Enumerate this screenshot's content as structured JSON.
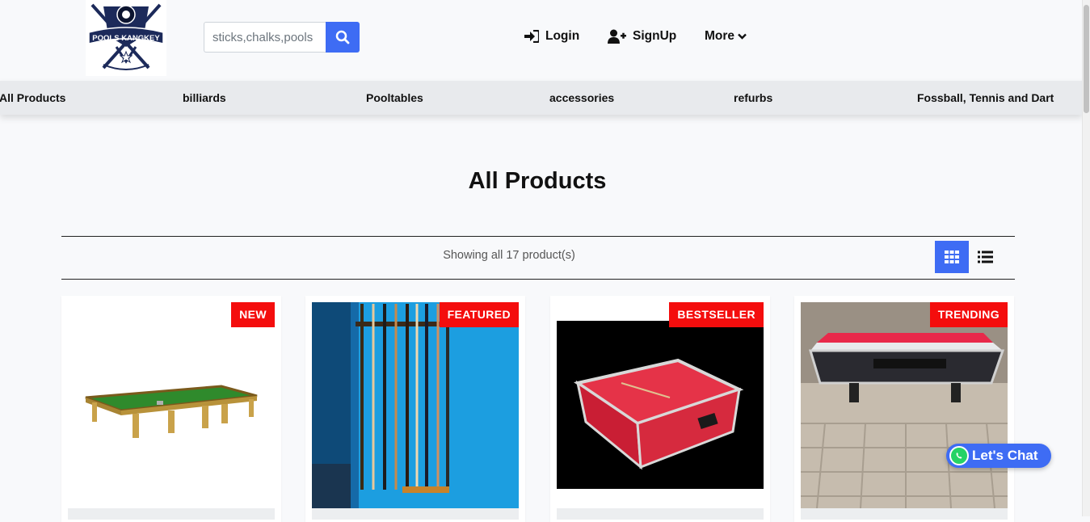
{
  "header": {
    "logo": {
      "text": "POOLS KANGKEY",
      "icon": "8-ball-crossed-cues-logo"
    },
    "search": {
      "placeholder": "sticks,chalks,pools",
      "button_icon": "search-icon"
    },
    "nav": [
      {
        "label": "Login",
        "icon": "sign-in-icon"
      },
      {
        "label": "SignUp",
        "icon": "user-plus-icon"
      },
      {
        "label": "More",
        "icon": "chevron-down-icon"
      }
    ]
  },
  "categories": [
    "All Products",
    "billiards",
    "Pooltables",
    "accessories",
    "refurbs",
    "Fossball, Tennis and Dart"
  ],
  "main": {
    "title": "All Products",
    "showing": "Showing all 17 product(s)",
    "view_toggle": [
      "grid-view-icon",
      "list-view-icon"
    ]
  },
  "products": [
    {
      "badge": "NEW",
      "image": "snooker-table-green-felt-gold-legs"
    },
    {
      "badge": "FEATURED",
      "image": "cue-sticks-wall-rack-blue-wall"
    },
    {
      "badge": "BESTSELLER",
      "image": "red-pool-table-black-background"
    },
    {
      "badge": "TRENDING",
      "image": "red-pool-table-outdoor-pavement"
    }
  ],
  "chat": {
    "label": "Let's Chat",
    "icon": "whatsapp-icon"
  },
  "colors": {
    "accent": "#3e6cf4",
    "badge": "#f40d0d",
    "catbar": "#e8eaed",
    "background": "#f8f9fb",
    "whatsapp": "#25d366"
  }
}
